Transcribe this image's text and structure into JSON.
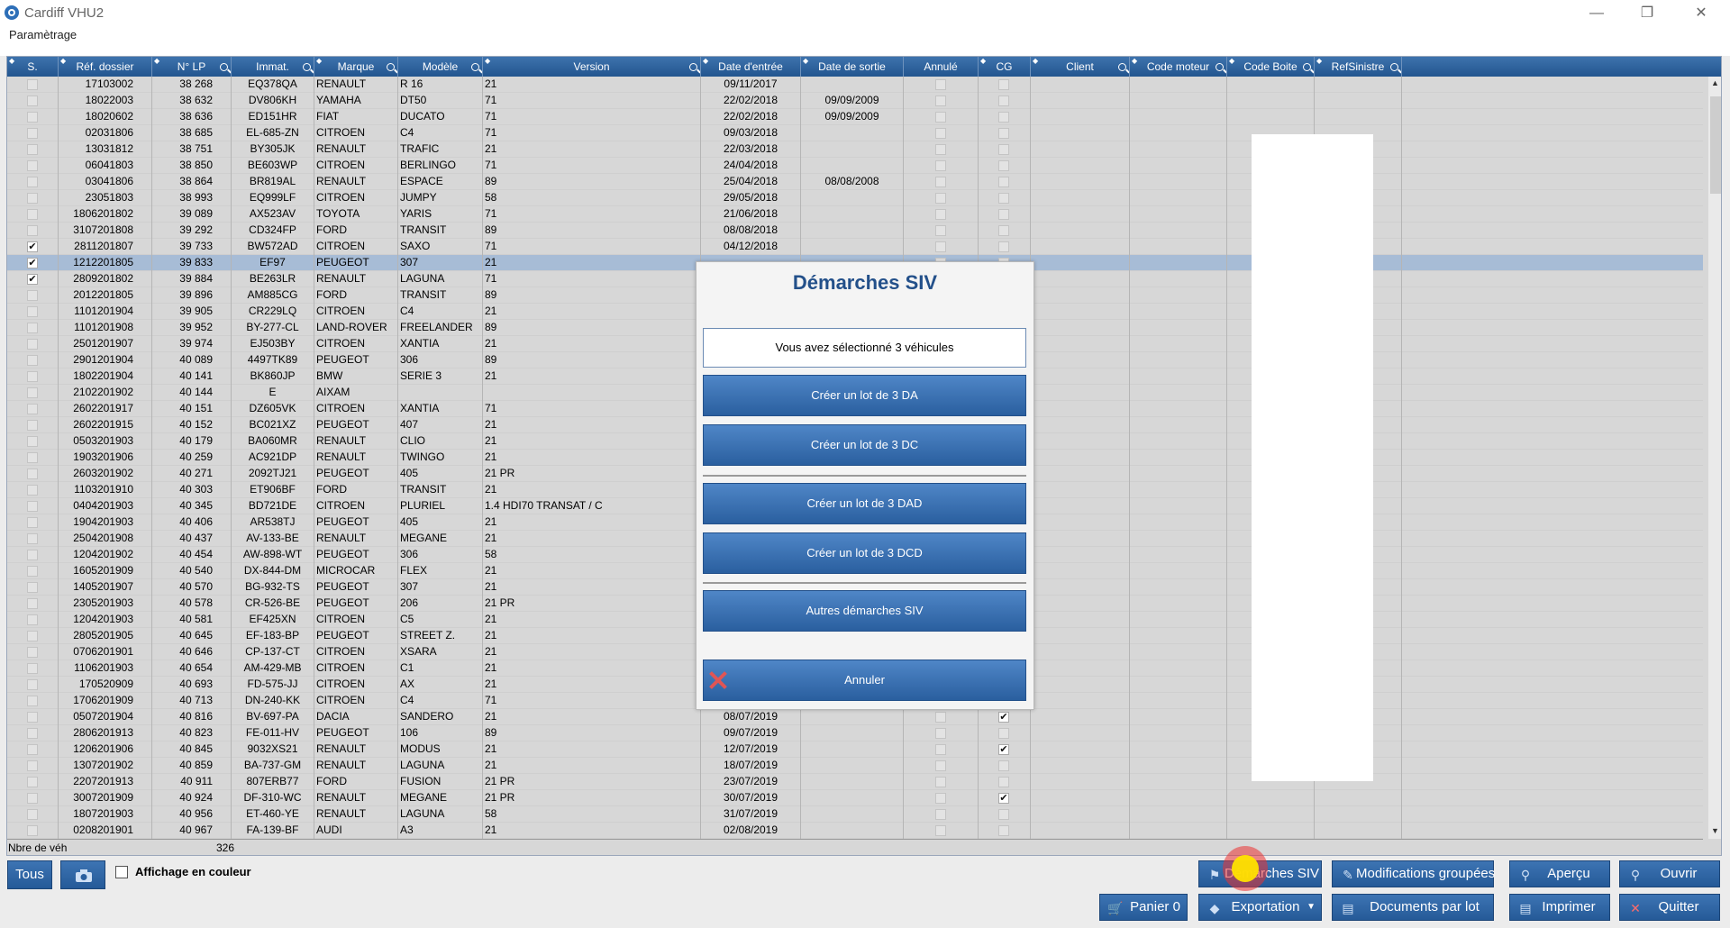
{
  "window": {
    "title": "Cardiff VHU2",
    "minimize": "—",
    "restore": "❐",
    "close": "✕"
  },
  "menu": {
    "items": [
      "Paramètrage"
    ]
  },
  "columns": [
    {
      "label": "S."
    },
    {
      "label": "Réf. dossier"
    },
    {
      "label": "N° LP"
    },
    {
      "label": "Immat."
    },
    {
      "label": "Marque"
    },
    {
      "label": "Modèle"
    },
    {
      "label": "Version"
    },
    {
      "label": "Date d'entrée"
    },
    {
      "label": "Date de sortie"
    },
    {
      "label": "Annulé"
    },
    {
      "label": "CG"
    },
    {
      "label": "Client"
    },
    {
      "label": "Code moteur"
    },
    {
      "label": "Code Boite"
    },
    {
      "label": "RefSinistre"
    }
  ],
  "rows": [
    {
      "s": false,
      "ref": "17103002",
      "lp": "38 268",
      "immat": "EQ378QA",
      "marque": "RENAULT",
      "modele": "R 16",
      "version": "21",
      "entree": "09/11/2017",
      "sortie": "",
      "cg": false
    },
    {
      "s": false,
      "ref": "18022003",
      "lp": "38 632",
      "immat": "DV806KH",
      "marque": "YAMAHA",
      "modele": "DT50",
      "version": "71",
      "entree": "22/02/2018",
      "sortie": "09/09/2009",
      "cg": false
    },
    {
      "s": false,
      "ref": "18020602",
      "lp": "38 636",
      "immat": "ED151HR",
      "marque": "FIAT",
      "modele": "DUCATO",
      "version": "71",
      "entree": "22/02/2018",
      "sortie": "09/09/2009",
      "cg": false
    },
    {
      "s": false,
      "ref": "02031806",
      "lp": "38 685",
      "immat": "EL-685-ZN",
      "marque": "CITROEN",
      "modele": "C4",
      "version": "71",
      "entree": "09/03/2018",
      "sortie": "",
      "cg": false
    },
    {
      "s": false,
      "ref": "13031812",
      "lp": "38 751",
      "immat": "BY305JK",
      "marque": "RENAULT",
      "modele": "TRAFIC",
      "version": "21",
      "entree": "22/03/2018",
      "sortie": "",
      "cg": false
    },
    {
      "s": false,
      "ref": "06041803",
      "lp": "38 850",
      "immat": "BE603WP",
      "marque": "CITROEN",
      "modele": "BERLINGO",
      "version": "71",
      "entree": "24/04/2018",
      "sortie": "",
      "cg": false
    },
    {
      "s": false,
      "ref": "03041806",
      "lp": "38 864",
      "immat": "BR819AL",
      "marque": "RENAULT",
      "modele": "ESPACE",
      "version": "89",
      "entree": "25/04/2018",
      "sortie": "08/08/2008",
      "cg": false
    },
    {
      "s": false,
      "ref": "23051803",
      "lp": "38 993",
      "immat": "EQ999LF",
      "marque": "CITROEN",
      "modele": "JUMPY",
      "version": "58",
      "entree": "29/05/2018",
      "sortie": "",
      "cg": false
    },
    {
      "s": false,
      "ref": "1806201802",
      "lp": "39 089",
      "immat": "AX523AV",
      "marque": "TOYOTA",
      "modele": "YARIS",
      "version": "71",
      "entree": "21/06/2018",
      "sortie": "",
      "cg": false
    },
    {
      "s": false,
      "ref": "3107201808",
      "lp": "39 292",
      "immat": "CD324FP",
      "marque": "FORD",
      "modele": "TRANSIT",
      "version": "89",
      "entree": "08/08/2018",
      "sortie": "",
      "cg": false
    },
    {
      "s": true,
      "ref": "2811201807",
      "lp": "39 733",
      "immat": "BW572AD",
      "marque": "CITROEN",
      "modele": "SAXO",
      "version": "71",
      "entree": "04/12/2018",
      "sortie": "",
      "cg": false
    },
    {
      "s": true,
      "ref": "1212201805",
      "lp": "39 833",
      "immat": "EF97",
      "marque": "PEUGEOT",
      "modele": "307",
      "version": "21",
      "entree": "",
      "sortie": "",
      "cg": false
    },
    {
      "s": true,
      "ref": "2809201802",
      "lp": "39 884",
      "immat": "BE263LR",
      "marque": "RENAULT",
      "modele": "LAGUNA",
      "version": "71",
      "entree": "",
      "sortie": "",
      "cg": false
    },
    {
      "s": false,
      "ref": "2012201805",
      "lp": "39 896",
      "immat": "AM885CG",
      "marque": "FORD",
      "modele": "TRANSIT",
      "version": "89",
      "entree": "",
      "sortie": "",
      "cg": false
    },
    {
      "s": false,
      "ref": "1101201904",
      "lp": "39 905",
      "immat": "CR229LQ",
      "marque": "CITROEN",
      "modele": "C4",
      "version": "21",
      "entree": "",
      "sortie": "",
      "cg": false
    },
    {
      "s": false,
      "ref": "1101201908",
      "lp": "39 952",
      "immat": "BY-277-CL",
      "marque": "LAND-ROVER",
      "modele": "FREELANDER",
      "version": "89",
      "entree": "",
      "sortie": "",
      "cg": false
    },
    {
      "s": false,
      "ref": "2501201907",
      "lp": "39 974",
      "immat": "EJ503BY",
      "marque": "CITROEN",
      "modele": "XANTIA",
      "version": "21",
      "entree": "",
      "sortie": "",
      "cg": true
    },
    {
      "s": false,
      "ref": "2901201904",
      "lp": "40 089",
      "immat": "4497TK89",
      "marque": "PEUGEOT",
      "modele": "306",
      "version": "89",
      "entree": "",
      "sortie": "",
      "cg": true
    },
    {
      "s": false,
      "ref": "1802201904",
      "lp": "40 141",
      "immat": "BK860JP",
      "marque": "BMW",
      "modele": "SERIE 3",
      "version": "21",
      "entree": "",
      "sortie": "",
      "cg": false
    },
    {
      "s": false,
      "ref": "2102201902",
      "lp": "40 144",
      "immat": "E",
      "marque": "AIXAM",
      "modele": "",
      "version": "",
      "entree": "",
      "sortie": "",
      "cg": false
    },
    {
      "s": false,
      "ref": "2602201917",
      "lp": "40 151",
      "immat": "DZ605VK",
      "marque": "CITROEN",
      "modele": "XANTIA",
      "version": "71",
      "entree": "",
      "sortie": "",
      "cg": false
    },
    {
      "s": false,
      "ref": "2602201915",
      "lp": "40 152",
      "immat": "BC021XZ",
      "marque": "PEUGEOT",
      "modele": "407",
      "version": "21",
      "entree": "",
      "sortie": "",
      "cg": true
    },
    {
      "s": false,
      "ref": "0503201903",
      "lp": "40 179",
      "immat": "BA060MR",
      "marque": "RENAULT",
      "modele": "CLIO",
      "version": "21",
      "entree": "",
      "sortie": "",
      "cg": false
    },
    {
      "s": false,
      "ref": "1903201906",
      "lp": "40 259",
      "immat": "AC921DP",
      "marque": "RENAULT",
      "modele": "TWINGO",
      "version": "21",
      "entree": "",
      "sortie": "",
      "cg": false
    },
    {
      "s": false,
      "ref": "2603201902",
      "lp": "40 271",
      "immat": "2092TJ21",
      "marque": "PEUGEOT",
      "modele": "405",
      "version": "21 PR",
      "entree": "",
      "sortie": "",
      "cg": true
    },
    {
      "s": false,
      "ref": "1103201910",
      "lp": "40 303",
      "immat": "ET906BF",
      "marque": "FORD",
      "modele": "TRANSIT",
      "version": "21",
      "entree": "",
      "sortie": "",
      "cg": false
    },
    {
      "s": false,
      "ref": "0404201903",
      "lp": "40 345",
      "immat": "BD721DE",
      "marque": "CITROEN",
      "modele": "PLURIEL",
      "version": "1.4 HDI70 TRANSAT / C",
      "entree": "",
      "sortie": "",
      "cg": false
    },
    {
      "s": false,
      "ref": "1904201903",
      "lp": "40 406",
      "immat": "AR538TJ",
      "marque": "PEUGEOT",
      "modele": "405",
      "version": "21",
      "entree": "",
      "sortie": "",
      "cg": false
    },
    {
      "s": false,
      "ref": "2504201908",
      "lp": "40 437",
      "immat": "AV-133-BE",
      "marque": "RENAULT",
      "modele": "MEGANE",
      "version": "21",
      "entree": "",
      "sortie": "",
      "cg": false
    },
    {
      "s": false,
      "ref": "1204201902",
      "lp": "40 454",
      "immat": "AW-898-WT",
      "marque": "PEUGEOT",
      "modele": "306",
      "version": "58",
      "entree": "",
      "sortie": "",
      "cg": false
    },
    {
      "s": false,
      "ref": "1605201909",
      "lp": "40 540",
      "immat": "DX-844-DM",
      "marque": "MICROCAR",
      "modele": "FLEX",
      "version": "21",
      "entree": "",
      "sortie": "",
      "cg": false
    },
    {
      "s": false,
      "ref": "1405201907",
      "lp": "40 570",
      "immat": "BG-932-TS",
      "marque": "PEUGEOT",
      "modele": "307",
      "version": "21",
      "entree": "",
      "sortie": "",
      "cg": false
    },
    {
      "s": false,
      "ref": "2305201903",
      "lp": "40 578",
      "immat": "CR-526-BE",
      "marque": "PEUGEOT",
      "modele": "206",
      "version": "21 PR",
      "entree": "",
      "sortie": "",
      "cg": true
    },
    {
      "s": false,
      "ref": "1204201903",
      "lp": "40 581",
      "immat": "EF425XN",
      "marque": "CITROEN",
      "modele": "C5",
      "version": "21",
      "entree": "",
      "sortie": "",
      "cg": false
    },
    {
      "s": false,
      "ref": "2805201905",
      "lp": "40 645",
      "immat": "EF-183-BP",
      "marque": "PEUGEOT",
      "modele": "STREET Z.",
      "version": "21",
      "entree": "",
      "sortie": "",
      "cg": false
    },
    {
      "s": false,
      "ref": "0706201901",
      "lp": "40 646",
      "immat": "CP-137-CT",
      "marque": "CITROEN",
      "modele": "XSARA",
      "version": "21",
      "entree": "",
      "sortie": "",
      "cg": true
    },
    {
      "s": false,
      "ref": "1106201903",
      "lp": "40 654",
      "immat": "AM-429-MB",
      "marque": "CITROEN",
      "modele": "C1",
      "version": "21",
      "entree": "",
      "sortie": "",
      "cg": true
    },
    {
      "s": false,
      "ref": "170520909",
      "lp": "40 693",
      "immat": "FD-575-JJ",
      "marque": "CITROEN",
      "modele": "AX",
      "version": "21",
      "entree": "",
      "sortie": "",
      "cg": false
    },
    {
      "s": false,
      "ref": "1706201909",
      "lp": "40 713",
      "immat": "DN-240-KK",
      "marque": "CITROEN",
      "modele": "C4",
      "version": "71",
      "entree": "",
      "sortie": "",
      "cg": false
    },
    {
      "s": false,
      "ref": "0507201904",
      "lp": "40 816",
      "immat": "BV-697-PA",
      "marque": "DACIA",
      "modele": "SANDERO",
      "version": "21",
      "entree": "08/07/2019",
      "sortie": "",
      "cg": true
    },
    {
      "s": false,
      "ref": "2806201913",
      "lp": "40 823",
      "immat": "FE-011-HV",
      "marque": "PEUGEOT",
      "modele": "106",
      "version": "89",
      "entree": "09/07/2019",
      "sortie": "",
      "cg": false
    },
    {
      "s": false,
      "ref": "1206201906",
      "lp": "40 845",
      "immat": "9032XS21",
      "marque": "RENAULT",
      "modele": "MODUS",
      "version": "21",
      "entree": "12/07/2019",
      "sortie": "",
      "cg": true
    },
    {
      "s": false,
      "ref": "1307201902",
      "lp": "40 859",
      "immat": "BA-737-GM",
      "marque": "RENAULT",
      "modele": "LAGUNA",
      "version": "21",
      "entree": "18/07/2019",
      "sortie": "",
      "cg": false
    },
    {
      "s": false,
      "ref": "2207201913",
      "lp": "40 911",
      "immat": "807ERB77",
      "marque": "FORD",
      "modele": "FUSION",
      "version": "21 PR",
      "entree": "23/07/2019",
      "sortie": "",
      "cg": false
    },
    {
      "s": false,
      "ref": "3007201909",
      "lp": "40 924",
      "immat": "DF-310-WC",
      "marque": "RENAULT",
      "modele": "MEGANE",
      "version": "21 PR",
      "entree": "30/07/2019",
      "sortie": "",
      "cg": true
    },
    {
      "s": false,
      "ref": "1807201903",
      "lp": "40 956",
      "immat": "ET-460-YE",
      "marque": "RENAULT",
      "modele": "LAGUNA",
      "version": "58",
      "entree": "31/07/2019",
      "sortie": "",
      "cg": false
    },
    {
      "s": false,
      "ref": "0208201901",
      "lp": "40 967",
      "immat": "FA-139-BF",
      "marque": "AUDI",
      "modele": "A3",
      "version": "21",
      "entree": "02/08/2019",
      "sortie": "",
      "cg": false
    }
  ],
  "footer": {
    "label": "Nbre de véh",
    "count": "326"
  },
  "dialog": {
    "title": "Démarches SIV",
    "info": "Vous avez sélectionné 3 véhicules",
    "btn_da": "Créer un lot de 3 DA",
    "btn_dc": "Créer un lot de 3 DC",
    "btn_dad": "Créer un lot de 3 DAD",
    "btn_dcd": "Créer un lot de 3 DCD",
    "btn_autres": "Autres démarches SIV",
    "btn_annuler": "Annuler"
  },
  "toolbar": {
    "tous": "Tous",
    "affichage": "Affichage en couleur",
    "demarches": "Démarches SIV",
    "modifications": "Modifications groupées",
    "apercu": "Aperçu",
    "ouvrir": "Ouvrir",
    "panier": "Panier 0",
    "exportation": "Exportation",
    "documents": "Documents par lot",
    "imprimer": "Imprimer",
    "quitter": "Quitter"
  },
  "colors": {
    "header": "#2a5f9f",
    "selected_row": "#a7bcd6",
    "dialog_title": "#23508a"
  }
}
